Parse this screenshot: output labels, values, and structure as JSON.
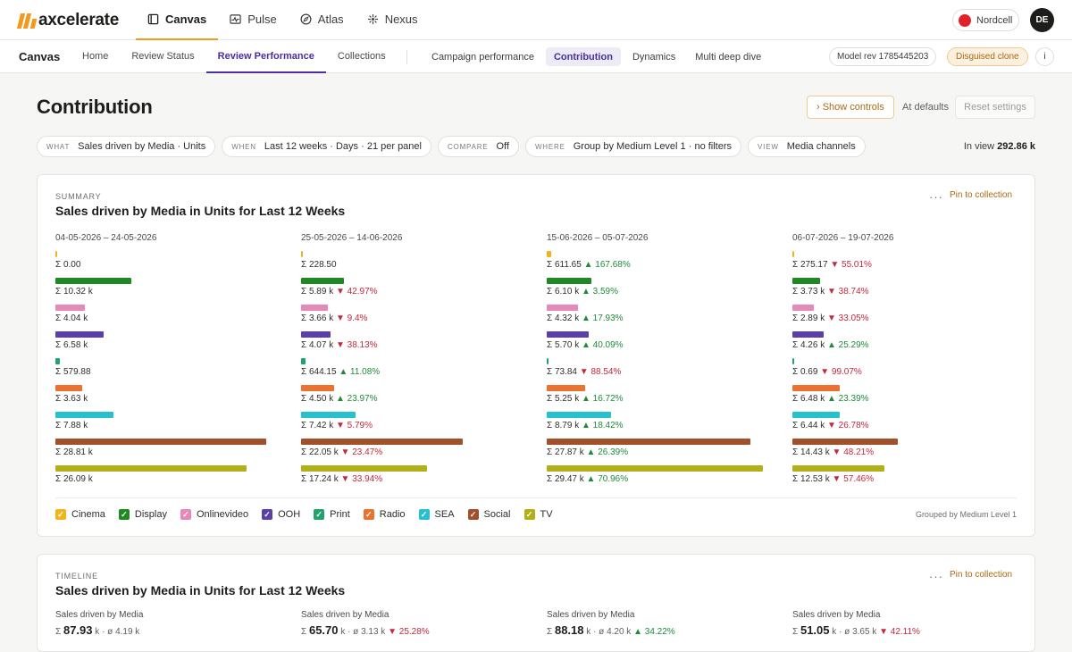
{
  "brand": {
    "name": "axcelerate",
    "accent": "#f29a1e"
  },
  "topnav": [
    {
      "label": "Canvas",
      "icon": "canvas-icon",
      "active": true
    },
    {
      "label": "Pulse",
      "icon": "pulse-icon",
      "active": false
    },
    {
      "label": "Atlas",
      "icon": "compass-icon",
      "active": false
    },
    {
      "label": "Nexus",
      "icon": "nexus-icon",
      "active": false
    }
  ],
  "client": {
    "name": "Nordcell",
    "color": "#e0232b"
  },
  "user": {
    "initials": "DE"
  },
  "subnav": {
    "title": "Canvas",
    "tabs": [
      "Home",
      "Review Status",
      "Review Performance",
      "Collections"
    ],
    "active_tab": "Review Performance",
    "page_tabs": [
      "Campaign performance",
      "Contribution",
      "Dynamics",
      "Multi deep dive"
    ],
    "active_page_tab": "Contribution",
    "model_badge": "Model rev 1785445203",
    "clone_badge": "Disguised clone",
    "info": "i"
  },
  "page": {
    "title": "Contribution",
    "show_controls": "› Show controls",
    "at_defaults": "At defaults",
    "reset": "Reset settings"
  },
  "filters": [
    {
      "key": "WHAT",
      "value": "Sales driven by Media · Units"
    },
    {
      "key": "WHEN",
      "value": "Last 12 weeks · Days · 21 per panel"
    },
    {
      "key": "COMPARE",
      "value": "Off"
    },
    {
      "key": "WHERE",
      "value": "Group by Medium Level 1 · no filters"
    },
    {
      "key": "VIEW",
      "value": "Media channels"
    }
  ],
  "in_view": {
    "label": "In view",
    "value": "292.86 k"
  },
  "summary": {
    "kicker": "SUMMARY",
    "title": "Sales driven by Media in Units for Last 12 Weeks",
    "more": "···",
    "pin": "Pin to collection",
    "grouped": "Grouped by Medium Level 1",
    "channels": [
      {
        "name": "Cinema",
        "color": "#f2b41e"
      },
      {
        "name": "Display",
        "color": "#1f8a23"
      },
      {
        "name": "Onlinevideo",
        "color": "#e48ab8"
      },
      {
        "name": "OOH",
        "color": "#5a3fa8"
      },
      {
        "name": "Print",
        "color": "#22a36e"
      },
      {
        "name": "Radio",
        "color": "#ec7230"
      },
      {
        "name": "SEA",
        "color": "#26c0cf"
      },
      {
        "name": "Social",
        "color": "#a1502c"
      },
      {
        "name": "TV",
        "color": "#b2b01a"
      }
    ],
    "panels": [
      {
        "range": "04-05-2026 – 24-05-2026",
        "rows": [
          {
            "value": 0,
            "text": "Σ 0.00",
            "change": "",
            "dir": ""
          },
          {
            "value": 10320,
            "text": "Σ 10.32 k",
            "change": "",
            "dir": ""
          },
          {
            "value": 4040,
            "text": "Σ 4.04 k",
            "change": "",
            "dir": ""
          },
          {
            "value": 6580,
            "text": "Σ 6.58 k",
            "change": "",
            "dir": ""
          },
          {
            "value": 579.88,
            "text": "Σ 579.88",
            "change": "",
            "dir": ""
          },
          {
            "value": 3630,
            "text": "Σ 3.63 k",
            "change": "",
            "dir": ""
          },
          {
            "value": 7880,
            "text": "Σ 7.88 k",
            "change": "",
            "dir": ""
          },
          {
            "value": 28810,
            "text": "Σ 28.81 k",
            "change": "",
            "dir": ""
          },
          {
            "value": 26090,
            "text": "Σ 26.09 k",
            "change": "",
            "dir": ""
          }
        ]
      },
      {
        "range": "25-05-2026 – 14-06-2026",
        "rows": [
          {
            "value": 228.5,
            "text": "Σ 228.50",
            "change": "",
            "dir": ""
          },
          {
            "value": 5890,
            "text": "Σ 5.89 k",
            "change": "▼ 42.97%",
            "dir": "down"
          },
          {
            "value": 3660,
            "text": "Σ 3.66 k",
            "change": "▼ 9.4%",
            "dir": "down"
          },
          {
            "value": 4070,
            "text": "Σ 4.07 k",
            "change": "▼ 38.13%",
            "dir": "down"
          },
          {
            "value": 644.15,
            "text": "Σ 644.15",
            "change": "▲ 11.08%",
            "dir": "up"
          },
          {
            "value": 4500,
            "text": "Σ 4.50 k",
            "change": "▲ 23.97%",
            "dir": "up"
          },
          {
            "value": 7420,
            "text": "Σ 7.42 k",
            "change": "▼ 5.79%",
            "dir": "down"
          },
          {
            "value": 22050,
            "text": "Σ 22.05 k",
            "change": "▼ 23.47%",
            "dir": "down"
          },
          {
            "value": 17240,
            "text": "Σ 17.24 k",
            "change": "▼ 33.94%",
            "dir": "down"
          }
        ]
      },
      {
        "range": "15-06-2026 – 05-07-2026",
        "rows": [
          {
            "value": 611.65,
            "text": "Σ 611.65",
            "change": "▲ 167.68%",
            "dir": "up"
          },
          {
            "value": 6100,
            "text": "Σ 6.10 k",
            "change": "▲ 3.59%",
            "dir": "up"
          },
          {
            "value": 4320,
            "text": "Σ 4.32 k",
            "change": "▲ 17.93%",
            "dir": "up"
          },
          {
            "value": 5700,
            "text": "Σ 5.70 k",
            "change": "▲ 40.09%",
            "dir": "up"
          },
          {
            "value": 73.84,
            "text": "Σ 73.84",
            "change": "▼ 88.54%",
            "dir": "down"
          },
          {
            "value": 5250,
            "text": "Σ 5.25 k",
            "change": "▲ 16.72%",
            "dir": "up"
          },
          {
            "value": 8790,
            "text": "Σ 8.79 k",
            "change": "▲ 18.42%",
            "dir": "up"
          },
          {
            "value": 27870,
            "text": "Σ 27.87 k",
            "change": "▲ 26.39%",
            "dir": "up"
          },
          {
            "value": 29470,
            "text": "Σ 29.47 k",
            "change": "▲ 70.96%",
            "dir": "up"
          }
        ]
      },
      {
        "range": "06-07-2026 – 19-07-2026",
        "rows": [
          {
            "value": 275.17,
            "text": "Σ 275.17",
            "change": "▼ 55.01%",
            "dir": "down"
          },
          {
            "value": 3730,
            "text": "Σ 3.73 k",
            "change": "▼ 38.74%",
            "dir": "down"
          },
          {
            "value": 2890,
            "text": "Σ 2.89 k",
            "change": "▼ 33.05%",
            "dir": "down"
          },
          {
            "value": 4260,
            "text": "Σ 4.26 k",
            "change": "▲ 25.29%",
            "dir": "up"
          },
          {
            "value": 0.69,
            "text": "Σ 0.69",
            "change": "▼ 99.07%",
            "dir": "down"
          },
          {
            "value": 6480,
            "text": "Σ 6.48 k",
            "change": "▲ 23.39%",
            "dir": "up"
          },
          {
            "value": 6440,
            "text": "Σ 6.44 k",
            "change": "▼ 26.78%",
            "dir": "down"
          },
          {
            "value": 14430,
            "text": "Σ 14.43 k",
            "change": "▼ 48.21%",
            "dir": "down"
          },
          {
            "value": 12530,
            "text": "Σ 12.53 k",
            "change": "▼ 57.46%",
            "dir": "down"
          }
        ]
      }
    ]
  },
  "timeline": {
    "kicker": "TIMELINE",
    "title": "Sales driven by Media in Units for Last 12 Weeks",
    "more": "···",
    "pin": "Pin to collection",
    "panels": [
      {
        "label": "Sales driven by Media",
        "sigma": "Σ",
        "total": "87.93",
        "rest": "k · ø 4.19 k",
        "change": "",
        "dir": ""
      },
      {
        "label": "Sales driven by Media",
        "sigma": "Σ",
        "total": "65.70",
        "rest": "k · ø 3.13 k",
        "change": "▼ 25.28%",
        "dir": "down"
      },
      {
        "label": "Sales driven by Media",
        "sigma": "Σ",
        "total": "88.18",
        "rest": "k · ø 4.20 k",
        "change": "▲ 34.22%",
        "dir": "up"
      },
      {
        "label": "Sales driven by Media",
        "sigma": "Σ",
        "total": "51.05",
        "rest": "k · ø 3.65 k",
        "change": "▼ 42.11%",
        "dir": "down"
      }
    ]
  }
}
